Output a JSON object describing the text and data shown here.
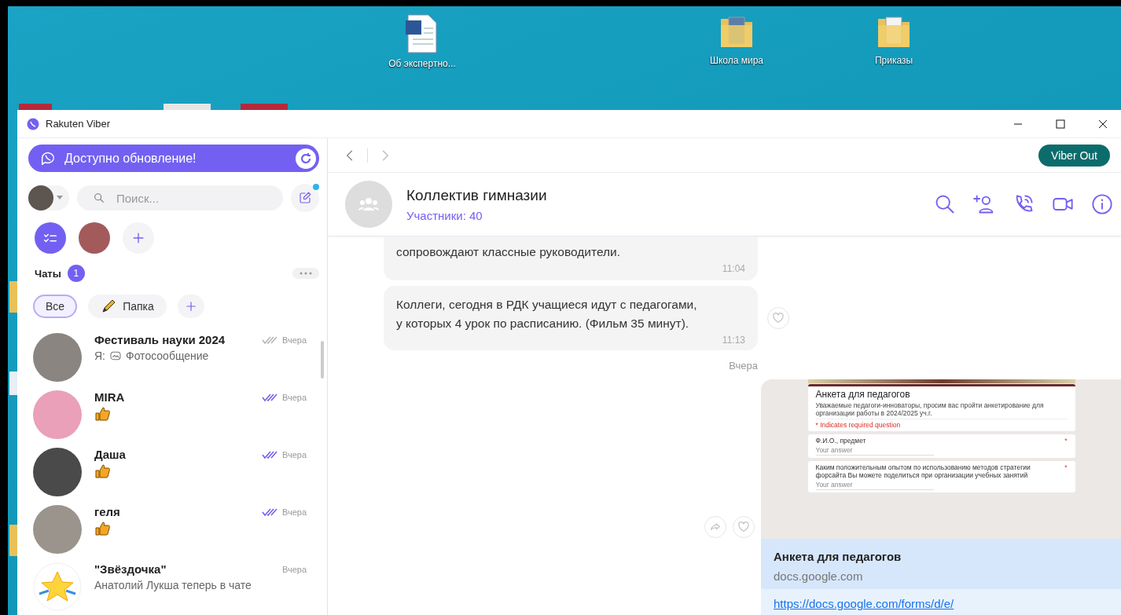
{
  "desktop_icons": [
    {
      "kind": "document",
      "label": "Об экспертно..."
    },
    {
      "kind": "folder",
      "label": "Школа мира"
    },
    {
      "kind": "folder",
      "label": "Приказы"
    }
  ],
  "window": {
    "title": "Rakuten Viber"
  },
  "update_banner": {
    "text": "Доступно обновление!"
  },
  "search": {
    "placeholder": "Поиск..."
  },
  "compose": {
    "notification": true
  },
  "chats_header": {
    "title": "Чаты",
    "unread": "1"
  },
  "filters": [
    {
      "kind": "text",
      "label": "Все",
      "selected": true
    },
    {
      "kind": "folder",
      "label": "Папка",
      "selected": false
    },
    {
      "kind": "add",
      "selected": false
    }
  ],
  "chat_list": [
    {
      "kind": "photo",
      "name": "Фестиваль науки 2024",
      "ticks": true,
      "read": false,
      "time": "Вчера",
      "sender": "Я:",
      "preview": "Фотосообщение"
    },
    {
      "kind": "thumbs",
      "name": "MIRA",
      "ticks": true,
      "read": true,
      "time": "Вчера"
    },
    {
      "kind": "thumbs",
      "name": "Даша",
      "ticks": true,
      "read": true,
      "time": "Вчера"
    },
    {
      "kind": "thumbs",
      "name": "геля",
      "ticks": true,
      "read": true,
      "time": "Вчера"
    },
    {
      "kind": "text",
      "name": "\"Звёздочка\"",
      "ticks": false,
      "time": "Вчера",
      "preview": "Анатолий Лукша теперь в чате"
    }
  ],
  "nav": {
    "viber_out": "Viber Out"
  },
  "conversation": {
    "title": "Коллектив гимназии",
    "subtitle": "Участники: 40"
  },
  "messages": [
    {
      "kind": "text",
      "text": "сопровождают классные руководители.",
      "time": "11:04",
      "reaction": false
    },
    {
      "kind": "text",
      "text": "Коллеги, сегодня в РДК учащиеся идут с педагогами,\nу которых 4 урок по расписанию. (Фильм 35 минут).",
      "time": "11:13",
      "reaction": true
    },
    {
      "kind": "date",
      "text": "Вчера"
    },
    {
      "kind": "link",
      "title": "Анкета для педагогов",
      "domain": "docs.google.com",
      "url": "https://docs.google.com/forms/d/e/",
      "form": {
        "title": "Анкета для педагогов",
        "description": "Уважаемые педагоги-инноваторы, просим вас пройти анкетирование для организации работы в 2024/2025 уч.г.",
        "required_note": "* Indicates required question",
        "questions": [
          {
            "label": "Ф.И.О., предмет",
            "mark": "*",
            "placeholder": "Your answer"
          },
          {
            "label": "Каким положительным опытом по использованию методов стратегии форсайта Вы можете поделиться при организации учебных занятий",
            "mark": "*",
            "placeholder": "Your answer"
          }
        ]
      }
    }
  ]
}
